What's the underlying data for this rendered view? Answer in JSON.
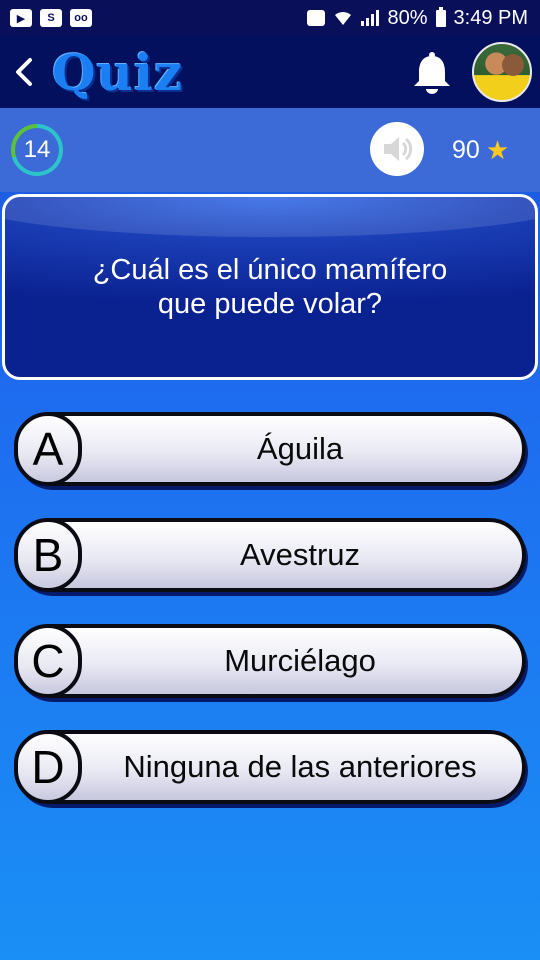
{
  "status_bar": {
    "battery": "80%",
    "time": "3:49 PM"
  },
  "header": {
    "back_icon": "chevron-left-icon",
    "title": "Quiz",
    "notification_icon": "bell-icon"
  },
  "info_bar": {
    "timer": "14",
    "sound_icon": "speaker-icon",
    "score": "90",
    "score_icon": "star-icon"
  },
  "question": {
    "line1": "¿Cuál es el único mamífero",
    "line2": "que puede volar?"
  },
  "answers": [
    {
      "letter": "A",
      "text": "Águila"
    },
    {
      "letter": "B",
      "text": "Avestruz"
    },
    {
      "letter": "C",
      "text": "Murciélago"
    },
    {
      "letter": "D",
      "text": "Ninguna de las anteriores"
    }
  ],
  "colors": {
    "header_bg": "#03105e",
    "info_bar_bg": "#3c6bd8",
    "title_color": "#1b7ef2",
    "star_color": "#ffc81e"
  }
}
